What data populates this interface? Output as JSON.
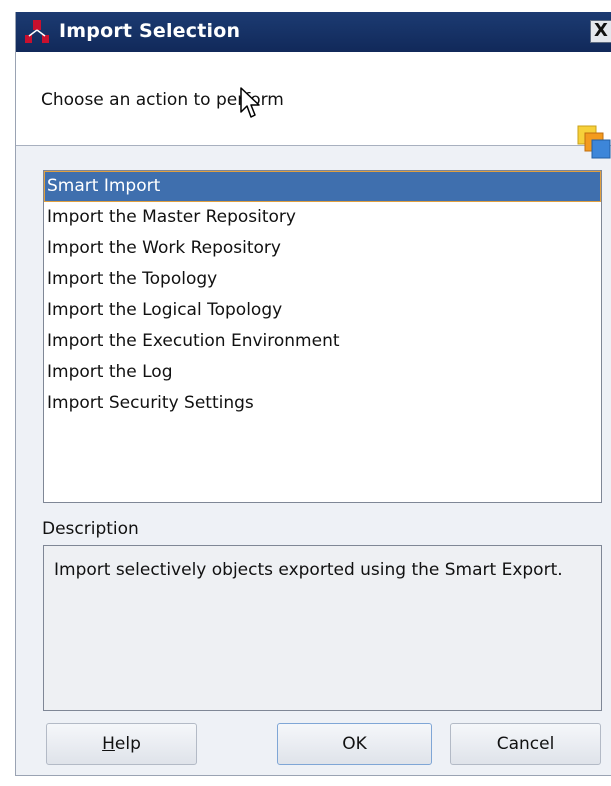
{
  "window": {
    "title": "Import Selection",
    "close_label": "X"
  },
  "header": {
    "prompt": "Choose an action to perform"
  },
  "actions": {
    "items": [
      "Smart Import",
      "Import the Master Repository",
      "Import the Work Repository",
      "Import the Topology",
      "Import the Logical Topology",
      "Import the Execution Environment",
      "Import the Log",
      "Import Security Settings"
    ],
    "selected_index": 0
  },
  "description": {
    "label": "Description",
    "text": "Import selectively objects exported using the Smart Export."
  },
  "buttons": {
    "help_mnemonic": "H",
    "help_rest": "elp",
    "ok": "OK",
    "cancel": "Cancel"
  },
  "icons": {
    "app": "odi-app-icon",
    "header": "stacked-squares-icon",
    "cursor": "mouse-pointer-icon"
  },
  "colors": {
    "titlebar": "#1c3b72",
    "selection": "#3f6fae",
    "selection_border": "#e0a040"
  }
}
